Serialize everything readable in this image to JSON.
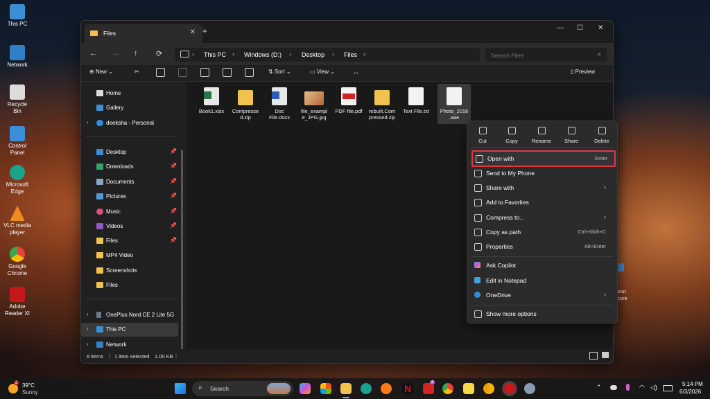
{
  "desktop": {
    "icons": [
      {
        "label": "This PC"
      },
      {
        "label": "Network"
      },
      {
        "label": "Recycle Bin"
      },
      {
        "label": "Control Panel"
      },
      {
        "label": "Microsoft Edge"
      },
      {
        "label": "VLC media player"
      },
      {
        "label": "Google Chrome"
      },
      {
        "label": "Adobe Reader XI"
      }
    ],
    "partial_icon_label": "bout\ncture"
  },
  "window": {
    "tab_title": "Files",
    "breadcrumb": [
      "This PC",
      "Windows (D:)",
      "Desktop",
      "Files"
    ],
    "search_placeholder": "Search Files",
    "toolbar": {
      "new_label": "New",
      "sort_label": "Sort",
      "view_label": "View",
      "more_label": "...",
      "preview_label": "Preview"
    },
    "sidebar": {
      "top": [
        "Home",
        "Gallery",
        "deeksha - Personal"
      ],
      "quick": [
        "Desktop",
        "Downloads",
        "Documents",
        "Pictures",
        "Music",
        "Videos",
        "Files",
        "MP4 Video",
        "Screenshots",
        "Files"
      ],
      "bottom": [
        "OnePlus Nord CE 2 Lite 5G",
        "This PC",
        "Network"
      ]
    },
    "files": [
      {
        "name": "Book1.xlsx",
        "icon": "excel-file-icon"
      },
      {
        "name": "Compressed.zip",
        "icon": "zip-folder-icon"
      },
      {
        "name": "Doc File.docx",
        "icon": "word-file-icon"
      },
      {
        "name": "file_example_JPG.jpg",
        "icon": "image-file-icon"
      },
      {
        "name": "PDF file.pdf",
        "icon": "pdf-file-icon"
      },
      {
        "name": "rebuilt.Compressed.zip",
        "icon": "zip-folder-icon"
      },
      {
        "name": "Text File.txt",
        "icon": "text-file-icon"
      },
      {
        "name": "Photo_2016.aae",
        "icon": "generic-file-icon"
      }
    ],
    "file_labels": [
      [
        "Book1.xlsx"
      ],
      [
        "Compresse",
        "d.zip"
      ],
      [
        "Doc",
        "File.docx"
      ],
      [
        "file_exampl",
        "e_JPG.jpg"
      ],
      [
        "PDF file.pdf"
      ],
      [
        "rebuilt.Com",
        "pressed.zip"
      ],
      [
        "Text File.txt"
      ],
      [
        "Photo_2016",
        ".aae"
      ]
    ],
    "status": {
      "items": "8 items",
      "selected": "1 item selected",
      "size": "1.00 KB"
    }
  },
  "context_menu": {
    "quick_actions": [
      "Cut",
      "Copy",
      "Rename",
      "Share",
      "Delete"
    ],
    "items": [
      {
        "label": "Open with",
        "shortcut": "Enter"
      },
      {
        "label": "Send to My Phone",
        "shortcut": ""
      },
      {
        "label": "Share with",
        "shortcut": ""
      },
      {
        "label": "Add to Favorites",
        "shortcut": ""
      },
      {
        "label": "Compress to...",
        "shortcut": ""
      },
      {
        "label": "Copy as path",
        "shortcut": "Ctrl+Shift+C"
      },
      {
        "label": "Properties",
        "shortcut": "Alt+Enter"
      },
      {
        "label": "Ask Copilot",
        "shortcut": ""
      },
      {
        "label": "Edit in Notepad",
        "shortcut": ""
      },
      {
        "label": "OneDrive",
        "shortcut": ""
      },
      {
        "label": "Show more options",
        "shortcut": ""
      }
    ]
  },
  "taskbar": {
    "weather_temp": "39°C",
    "weather_desc": "Sunny",
    "weather_badge": "2",
    "search_label": "Search",
    "time": "5:14 PM",
    "date": "6/3/2026",
    "app_badge": "4"
  },
  "colors": {
    "accent_highlight": "#e03b3b",
    "folder": "#f2c14e"
  }
}
